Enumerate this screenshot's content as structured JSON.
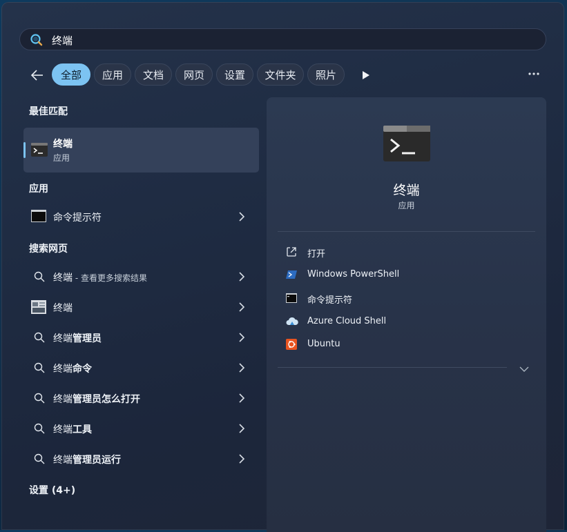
{
  "search": {
    "query": "终端"
  },
  "filters": {
    "tabs": [
      "全部",
      "应用",
      "文档",
      "网页",
      "设置",
      "文件夹",
      "照片"
    ],
    "active_index": 0
  },
  "sections": {
    "best_match": "最佳匹配",
    "apps": "应用",
    "web": "搜索网页",
    "settings": "设置 (4+)"
  },
  "best_match": {
    "title": "终端",
    "subtitle": "应用"
  },
  "apps": [
    {
      "label": "命令提示符"
    }
  ],
  "web_results": [
    {
      "query": "终端",
      "suffix": " - 查看更多搜索结果",
      "icon": "search-icon"
    },
    {
      "query": "终端",
      "suffix": "",
      "icon": "web-thumbnail-icon"
    },
    {
      "query": "终端",
      "suffix": "管理员",
      "icon": "search-icon"
    },
    {
      "query": "终端",
      "suffix": "命令",
      "icon": "search-icon"
    },
    {
      "query": "终端",
      "suffix": "管理员怎么打开",
      "icon": "search-icon"
    },
    {
      "query": "终端",
      "suffix": "工具",
      "icon": "search-icon"
    },
    {
      "query": "终端",
      "suffix": "管理员运行",
      "icon": "search-icon"
    }
  ],
  "detail": {
    "title": "终端",
    "subtitle": "应用",
    "actions": [
      {
        "label": "打开",
        "icon": "open-external-icon"
      },
      {
        "label": "Windows PowerShell",
        "icon": "powershell-icon"
      },
      {
        "label": "命令提示符",
        "icon": "cmd-icon"
      },
      {
        "label": "Azure Cloud Shell",
        "icon": "azure-cloud-icon"
      },
      {
        "label": "Ubuntu",
        "icon": "ubuntu-icon"
      }
    ]
  },
  "colors": {
    "accent": "#7cc3f2",
    "panel": "#1f2c43"
  }
}
